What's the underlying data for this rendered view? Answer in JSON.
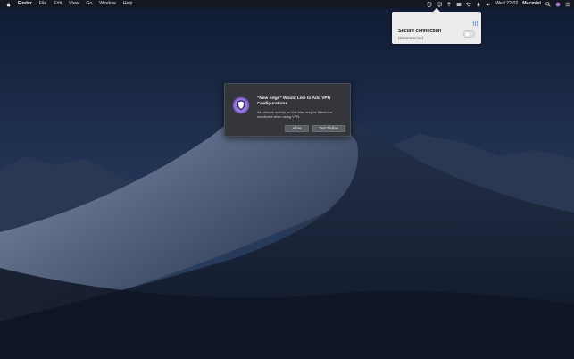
{
  "menubar": {
    "apple_icon": "apple-icon",
    "items": [
      "Finder",
      "File",
      "Edit",
      "View",
      "Go",
      "Window",
      "Help"
    ],
    "status_icons": [
      "vpn-shield-icon",
      "display-icon",
      "cloud-upload-icon",
      "flag-icon",
      "heart-icon",
      "bell-icon",
      "volume-icon"
    ],
    "clock": "Wed 22:02",
    "user": "Macmini",
    "right_icons": [
      "spotlight-search-icon",
      "siri-icon",
      "notification-center-icon"
    ]
  },
  "vpn_popover": {
    "title": "Secure connection",
    "status": "Disconnected",
    "toggle_on": false
  },
  "dialog": {
    "title": "“New Edge” Would Like to Add VPN Configurations",
    "body": "All network activity on this Mac may be filtered or monitored when using VPN.",
    "allow_label": "Allow",
    "deny_label": "Don’t Allow",
    "accent": "#7a5bbf"
  }
}
